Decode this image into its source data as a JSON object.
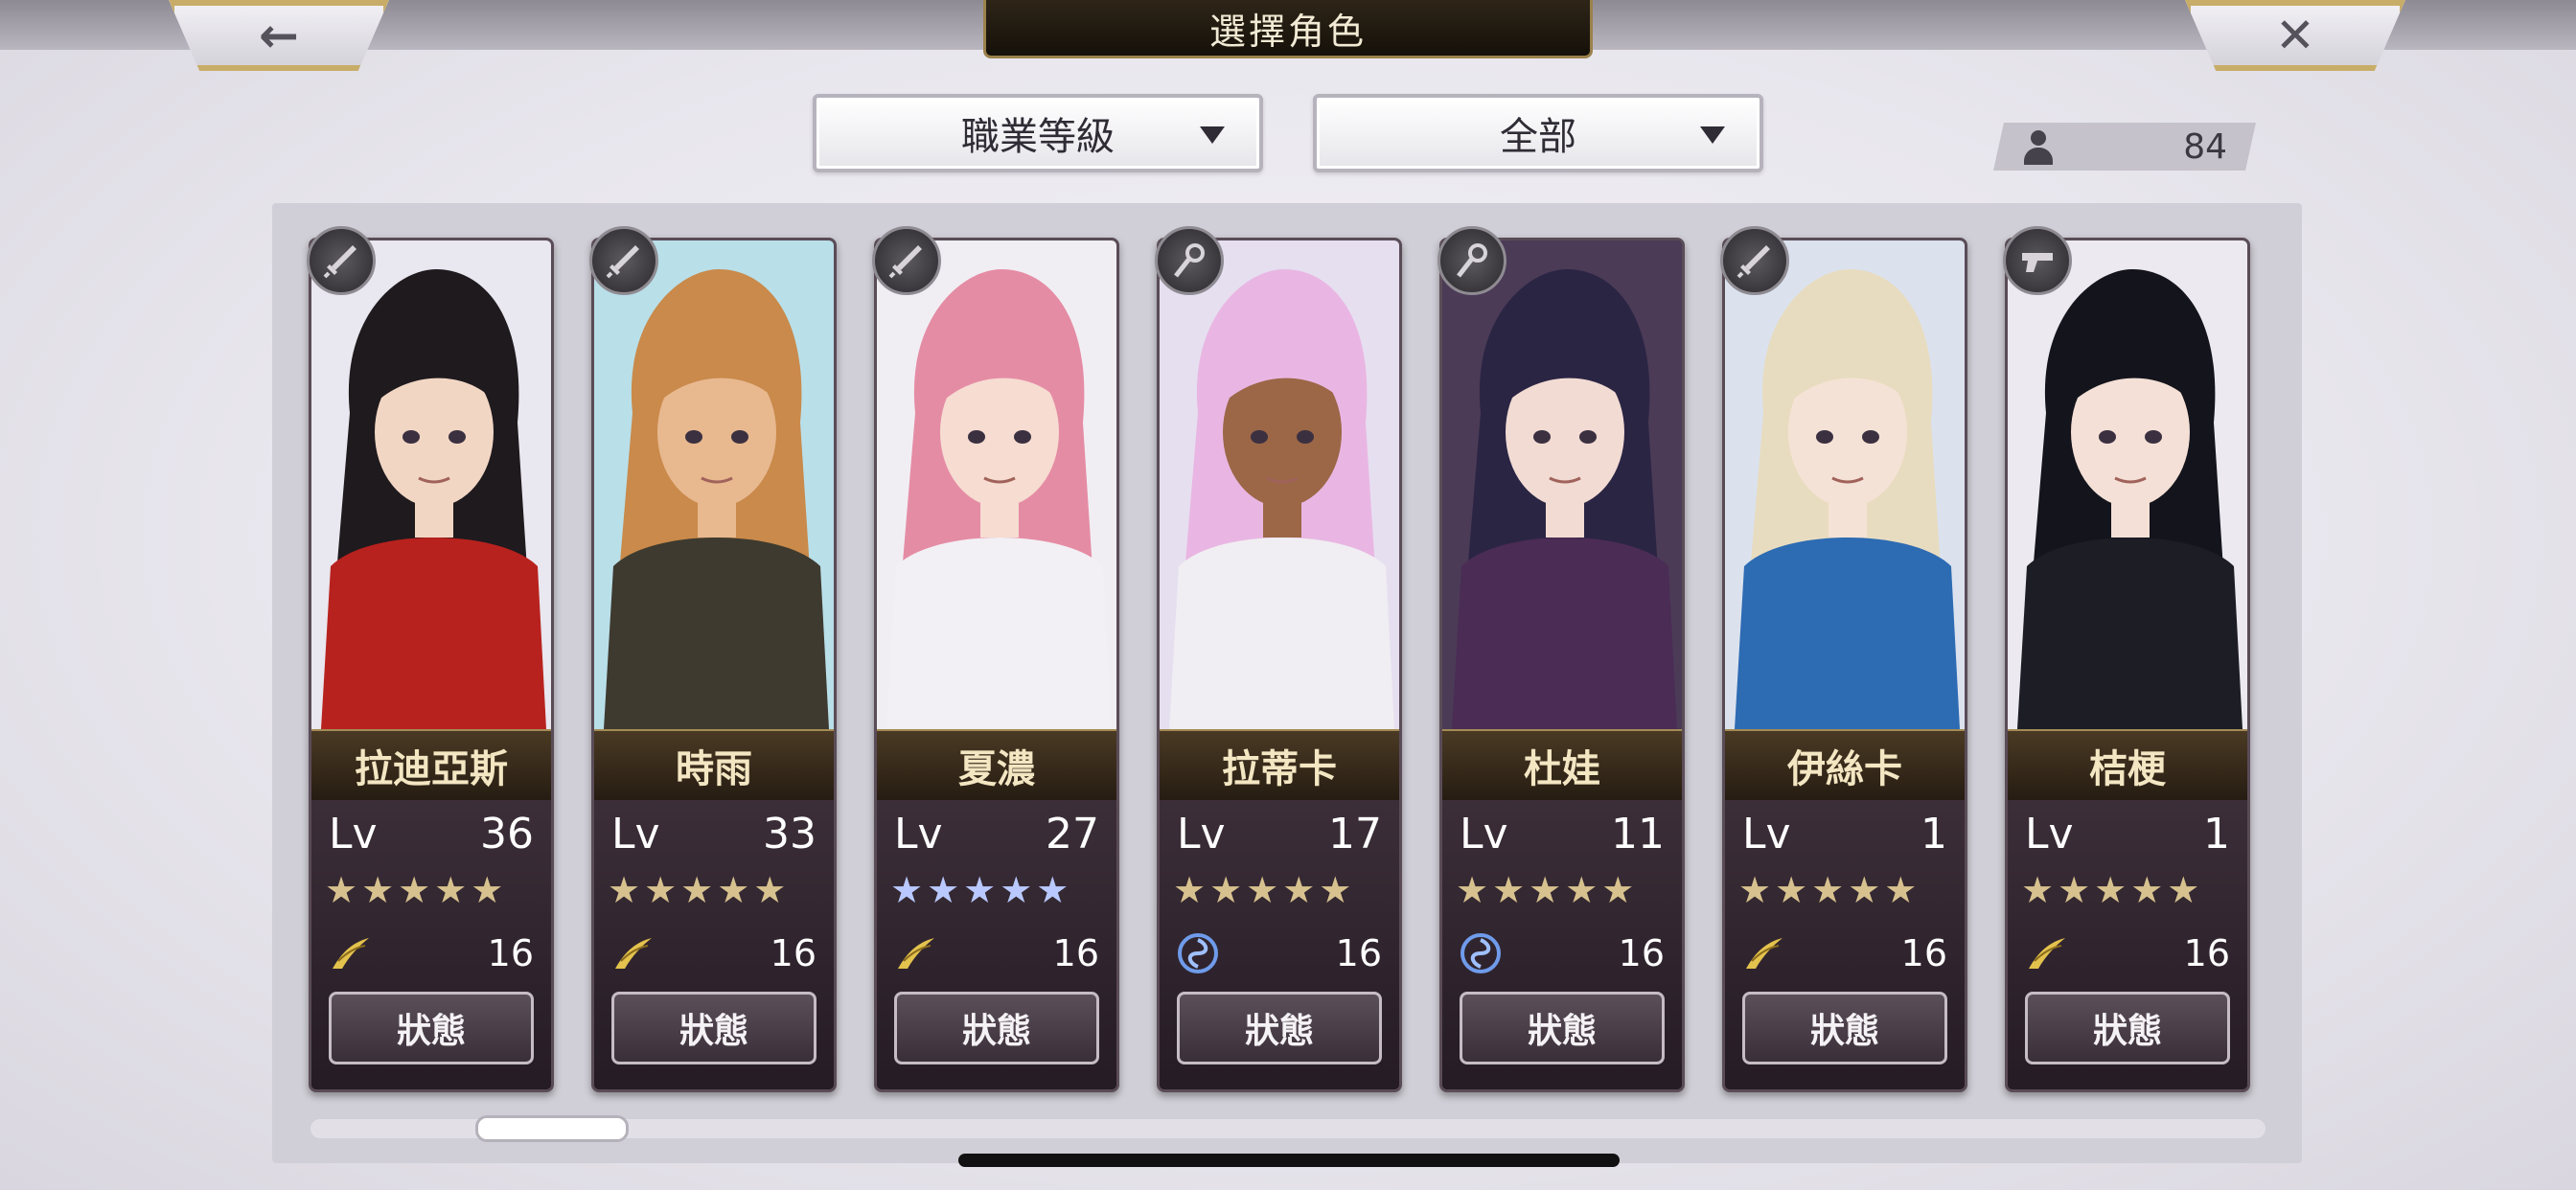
{
  "header": {
    "title": "選擇角色",
    "back_icon": "←",
    "close_icon": "✕"
  },
  "filters": {
    "sort_label": "職業等級",
    "category_label": "全部"
  },
  "character_count": "84",
  "status_label": "狀態",
  "characters": [
    {
      "name": "拉迪亞斯",
      "lv": "36",
      "stars": "★★★★★",
      "star_color": "gold",
      "element": "wind",
      "power": "16",
      "weapon": "sword",
      "portrait": {
        "bg": "#e9e7ef",
        "hair": "#1f1a1e",
        "skin": "#f2d6c4",
        "outfit": "#b8221e"
      }
    },
    {
      "name": "時雨",
      "lv": "33",
      "stars": "★★★★★",
      "star_color": "gold",
      "element": "wind",
      "power": "16",
      "weapon": "sword",
      "portrait": {
        "bg": "#b9dfe9",
        "hair": "#c98a4b",
        "skin": "#e8b88f",
        "outfit": "#3e3a2f"
      }
    },
    {
      "name": "夏濃",
      "lv": "27",
      "stars": "★★★★★",
      "star_color": "blue",
      "element": "wind",
      "power": "16",
      "weapon": "sword",
      "portrait": {
        "bg": "#f1eef3",
        "hair": "#e58ca5",
        "skin": "#f6dcd1",
        "outfit": "#f2f0f4"
      }
    },
    {
      "name": "拉蒂卡",
      "lv": "17",
      "stars": "★★★★★",
      "star_color": "gold",
      "element": "water",
      "power": "16",
      "weapon": "staff",
      "portrait": {
        "bg": "#e6dff0",
        "hair": "#e9b6e3",
        "skin": "#9b6747",
        "outfit": "#f0eef2"
      }
    },
    {
      "name": "杜娃",
      "lv": "11",
      "stars": "★★★★★",
      "star_color": "gold",
      "element": "water",
      "power": "16",
      "weapon": "staff",
      "portrait": {
        "bg": "#4b3b57",
        "hair": "#2b2544",
        "skin": "#f1dbd3",
        "outfit": "#4b2c55"
      }
    },
    {
      "name": "伊絲卡",
      "lv": "1",
      "stars": "★★★★★",
      "star_color": "gold",
      "element": "wind",
      "power": "16",
      "weapon": "sword",
      "portrait": {
        "bg": "#dbe2ee",
        "hair": "#e8dcc0",
        "skin": "#f5e2d6",
        "outfit": "#2d6bb3"
      }
    },
    {
      "name": "桔梗",
      "lv": "1",
      "stars": "★★★★★",
      "star_color": "gold",
      "element": "wind",
      "power": "16",
      "weapon": "gun",
      "portrait": {
        "bg": "#ece9f0",
        "hair": "#14141c",
        "skin": "#f4e0d6",
        "outfit": "#1c1d25"
      }
    }
  ]
}
